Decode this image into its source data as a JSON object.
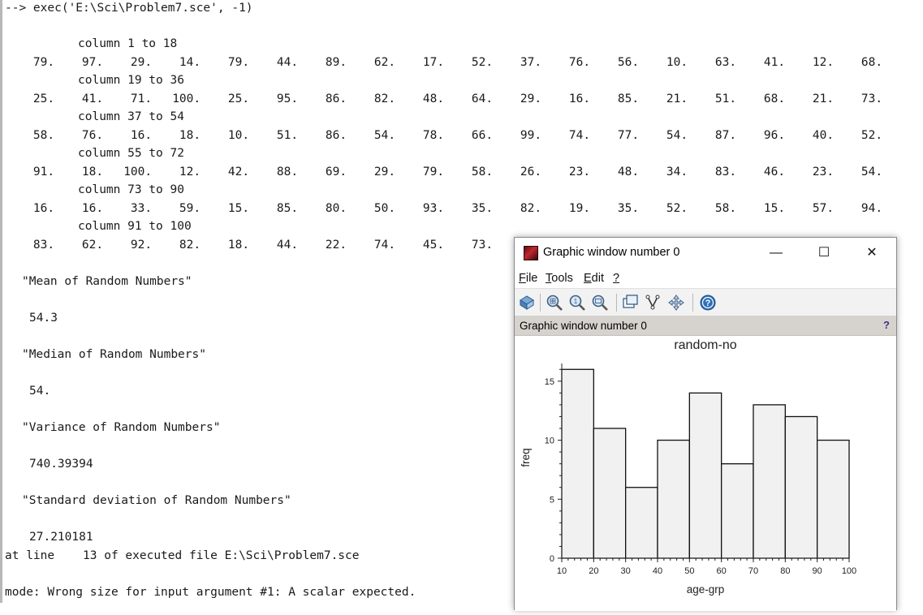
{
  "console": {
    "command": "--> exec('E:\\Sci\\Problem7.sce', -1)",
    "blocks": [
      {
        "header": "column 1 to 18",
        "values": [
          "79.",
          "97.",
          "29.",
          "14.",
          "79.",
          "44.",
          "89.",
          "62.",
          "17.",
          "52.",
          "37.",
          "76.",
          "56.",
          "10.",
          "63.",
          "41.",
          "12.",
          "68."
        ]
      },
      {
        "header": "column 19 to 36",
        "values": [
          "25.",
          "41.",
          "71.",
          "100.",
          "25.",
          "95.",
          "86.",
          "82.",
          "48.",
          "64.",
          "29.",
          "16.",
          "85.",
          "21.",
          "51.",
          "68.",
          "21.",
          "73."
        ]
      },
      {
        "header": "column 37 to 54",
        "values": [
          "58.",
          "76.",
          "16.",
          "18.",
          "10.",
          "51.",
          "86.",
          "54.",
          "78.",
          "66.",
          "99.",
          "74.",
          "77.",
          "54.",
          "87.",
          "96.",
          "40.",
          "52."
        ]
      },
      {
        "header": "column 55 to 72",
        "values": [
          "91.",
          "18.",
          "100.",
          "12.",
          "42.",
          "88.",
          "69.",
          "29.",
          "79.",
          "58.",
          "26.",
          "23.",
          "48.",
          "34.",
          "83.",
          "46.",
          "23.",
          "54."
        ]
      },
      {
        "header": "column 73 to 90",
        "values": [
          "16.",
          "16.",
          "33.",
          "59.",
          "15.",
          "85.",
          "80.",
          "50.",
          "93.",
          "35.",
          "82.",
          "19.",
          "35.",
          "52.",
          "58.",
          "15.",
          "57.",
          "94."
        ]
      },
      {
        "header": "column 91 to 100",
        "values": [
          "83.",
          "62.",
          "92.",
          "82.",
          "18.",
          "44.",
          "22.",
          "74.",
          "45.",
          "73."
        ]
      }
    ],
    "mean_label": "\"Mean of Random Numbers\"",
    "mean_value": "54.3",
    "median_label": "\"Median of Random Numbers\"",
    "median_value": "54.",
    "variance_label": "\"Variance of Random Numbers\"",
    "variance_value": "740.39394",
    "std_label": "\"Standard deviation of Random Numbers\"",
    "std_value": "27.210181",
    "error_line1": "at line    13 of executed file E:\\Sci\\Problem7.sce",
    "error_line2": "mode: Wrong size for input argument #1: A scalar expected."
  },
  "graphic_window": {
    "title": "Graphic window number 0",
    "minimize": "—",
    "maximize": "☐",
    "close": "✕",
    "menus": [
      {
        "first": "F",
        "rest": "ile"
      },
      {
        "first": "T",
        "rest": "ools"
      },
      {
        "first": "E",
        "rest": "dit"
      },
      {
        "first": "?",
        "rest": ""
      }
    ],
    "toolbar_icons": [
      "rotate-icon",
      "zoom-area-icon",
      "zoom-in-icon",
      "zoom-out-icon",
      "datatip-icon",
      "edit-icon",
      "pan-icon",
      "help-icon"
    ],
    "infobar_text": "Graphic window number 0",
    "infobar_help": "?",
    "colors": {
      "bar_fill": "#f1f1f1",
      "bar_stroke": "#111111"
    }
  },
  "chart_data": {
    "type": "bar",
    "title": "random-no",
    "xlabel": "age-grp",
    "ylabel": "freq",
    "bins": [
      [
        10,
        20
      ],
      [
        20,
        30
      ],
      [
        30,
        40
      ],
      [
        40,
        50
      ],
      [
        50,
        60
      ],
      [
        60,
        70
      ],
      [
        70,
        80
      ],
      [
        80,
        90
      ],
      [
        90,
        100
      ]
    ],
    "values": [
      16,
      11,
      6,
      10,
      14,
      8,
      13,
      12,
      10
    ],
    "xticks": [
      10,
      20,
      30,
      40,
      50,
      60,
      70,
      80,
      90,
      100
    ],
    "yticks": [
      0,
      5,
      10,
      15
    ],
    "xlim": [
      10,
      100
    ],
    "ylim": [
      0,
      16.5
    ],
    "grid": false
  }
}
